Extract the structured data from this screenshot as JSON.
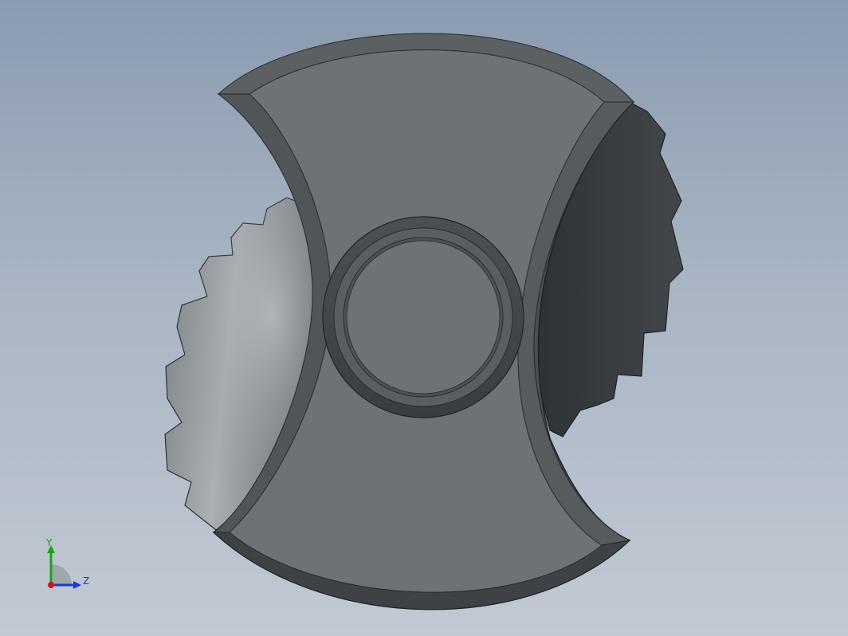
{
  "viewport": {
    "model": "cam-part",
    "colors": {
      "background_top": "#8a9bb0",
      "background_bottom": "#c2c9d3",
      "face": "#6e7276",
      "bevel": "#54585b",
      "edge": "#26292b",
      "teeth_light": "#a4a9ad",
      "teeth_dark": "#3a3d40"
    }
  },
  "triad": {
    "y_label": "Y",
    "z_label": "Z",
    "colors": {
      "y_axis": "#1aa31a",
      "z_axis": "#1a3ccc",
      "x_axis": "#cc1a1a"
    }
  }
}
